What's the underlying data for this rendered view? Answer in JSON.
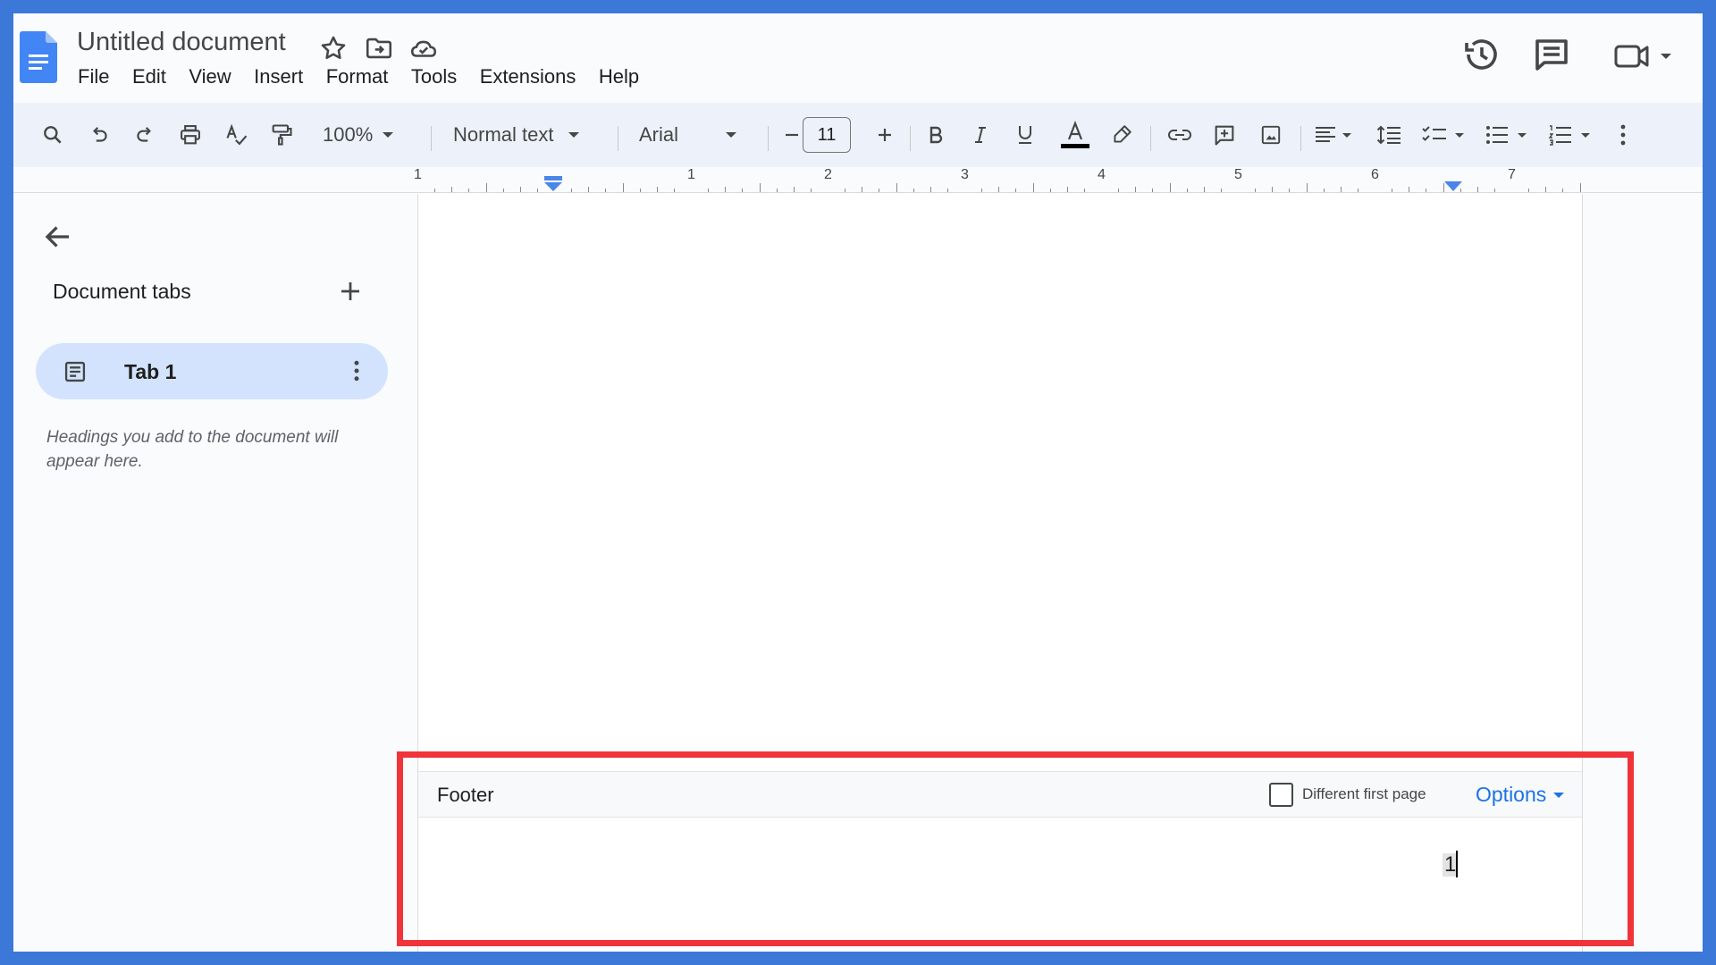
{
  "title_bar": {
    "doc_title": "Untitled document",
    "menu": [
      "File",
      "Edit",
      "View",
      "Insert",
      "Format",
      "Tools",
      "Extensions",
      "Help"
    ]
  },
  "toolbar": {
    "zoom": "100%",
    "style": "Normal text",
    "font": "Arial",
    "font_size": "11"
  },
  "ruler": {
    "labels": [
      "1",
      "1",
      "2",
      "3",
      "4",
      "5",
      "6",
      "7"
    ]
  },
  "sidebar": {
    "title": "Document tabs",
    "tabs": [
      {
        "label": "Tab 1"
      }
    ],
    "hint": "Headings you add to the document will appear here."
  },
  "footer": {
    "label": "Footer",
    "different_first_page_label": "Different first page",
    "different_first_page_checked": false,
    "options_label": "Options",
    "page_number": "1"
  },
  "colors": {
    "frame_border": "#3b78d8",
    "toolbar_bg": "#edf2fa",
    "tab_active_bg": "#d3e3fd",
    "accent": "#1a73e8",
    "highlight": "#f0343a"
  },
  "icons": {
    "title_bar": [
      "docs-logo-icon",
      "star-icon",
      "move-folder-icon",
      "cloud-status-icon",
      "version-history-icon",
      "comments-icon",
      "meet-camera-icon"
    ],
    "toolbar": [
      "search-icon",
      "undo-icon",
      "redo-icon",
      "print-icon",
      "spellcheck-icon",
      "paint-format-icon",
      "bold-icon",
      "italic-icon",
      "underline-icon",
      "text-color-icon",
      "highlight-icon",
      "link-icon",
      "add-comment-icon",
      "insert-image-icon",
      "align-icon",
      "line-spacing-icon",
      "checklist-icon",
      "bullet-list-icon",
      "numbered-list-icon",
      "more-vert-icon"
    ]
  }
}
